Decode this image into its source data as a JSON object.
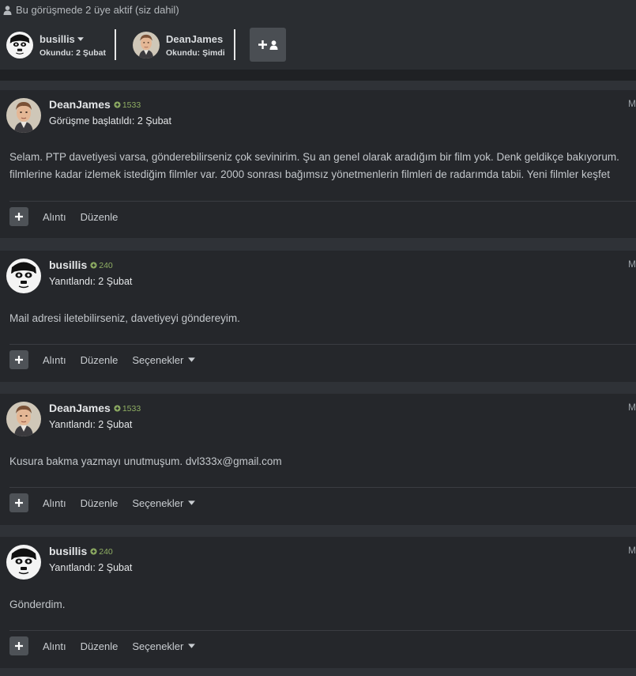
{
  "header": {
    "note": "Bu görüşmede 2 üye aktif (siz dahil)",
    "participants": [
      {
        "name": "busillis",
        "read": "Okundu: 2 Şubat"
      },
      {
        "name": "DeanJames",
        "read": "Okundu: Şimdi"
      }
    ],
    "add_button_icon": "add-user-icon"
  },
  "posts": [
    {
      "author": "DeanJames",
      "reputation": "1533",
      "meta": "Görüşme başlatıldı: 2 Şubat",
      "corner": "M",
      "lines": [
        "Selam.  PTP davetiyesi varsa, gönderebilirseniz çok sevinirim. Şu an genel olarak aradığım bir film yok. Denk geldikçe bakıyorum.",
        "filmlerine kadar izlemek istediğim filmler var. 2000 sonrası bağımsız yönetmenlerin filmleri de radarımda tabii. Yeni filmler keşfet"
      ],
      "actions": [
        "Alıntı",
        "Düzenle"
      ]
    },
    {
      "author": "busillis",
      "reputation": "240",
      "meta": "Yanıtlandı: 2 Şubat",
      "corner": "M",
      "lines": [
        "Mail adresi iletebilirseniz, davetiyeyi göndereyim."
      ],
      "actions": [
        "Alıntı",
        "Düzenle",
        "Seçenekler"
      ]
    },
    {
      "author": "DeanJames",
      "reputation": "1533",
      "meta": "Yanıtlandı: 2 Şubat",
      "corner": "M",
      "lines": [
        "Kusura bakma yazmayı unutmuşum. dvl333x@gmail.com"
      ],
      "actions": [
        "Alıntı",
        "Düzenle",
        "Seçenekler"
      ]
    },
    {
      "author": "busillis",
      "reputation": "240",
      "meta": "Yanıtlandı: 2 Şubat",
      "corner": "M",
      "lines": [
        "Gönderdim."
      ],
      "actions": [
        "Alıntı",
        "Düzenle",
        "Seçenekler"
      ]
    }
  ],
  "colors": {
    "page_background": "#2a2d31",
    "post_background": "#25272b",
    "reputation_green": "#8fae63",
    "button_gray": "#4e5257"
  }
}
